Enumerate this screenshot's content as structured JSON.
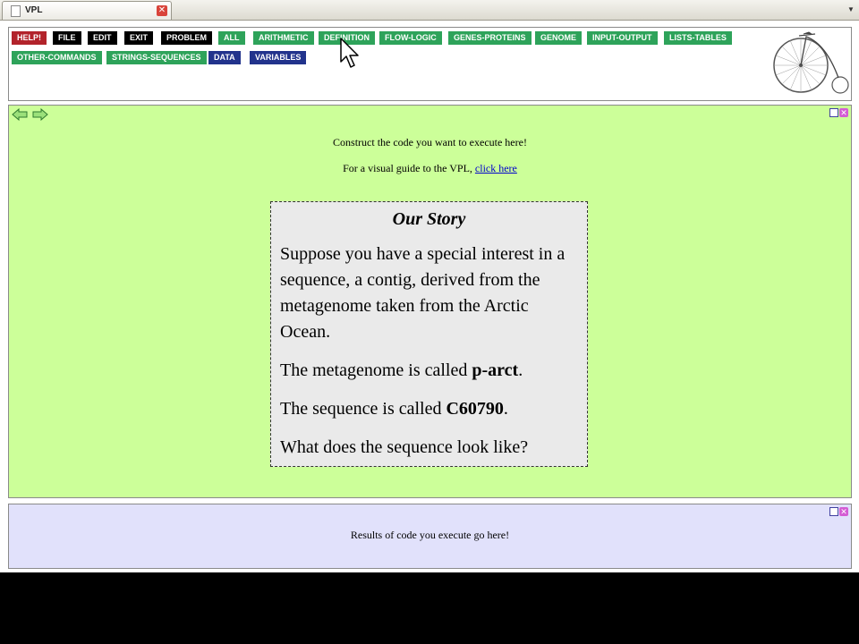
{
  "browser": {
    "tab_title": "VPL",
    "tab_close_glyph": "✕",
    "dropdown_glyph": "▼",
    "tab_icon": "page-icon"
  },
  "toolbar": {
    "buttons": [
      {
        "label": "HELP!",
        "color": "#b2232b"
      },
      {
        "label": "FILE",
        "color": "#000000"
      },
      {
        "label": "EDIT",
        "color": "#000000"
      },
      {
        "label": "EXIT",
        "color": "#000000"
      },
      {
        "label": "PROBLEM",
        "color": "#000000"
      },
      {
        "label": "ALL",
        "color": "#2ea35a"
      },
      {
        "label": "ARITHMETIC",
        "color": "#2ea35a"
      },
      {
        "label": "DEFINITION",
        "color": "#2ea35a"
      },
      {
        "label": "FLOW-LOGIC",
        "color": "#2ea35a"
      },
      {
        "label": "GENES-PROTEINS",
        "color": "#2ea35a"
      },
      {
        "label": "GENOME",
        "color": "#2ea35a"
      },
      {
        "label": "INPUT-OUTPUT",
        "color": "#2ea35a"
      },
      {
        "label": "LISTS-TABLES",
        "color": "#2ea35a"
      },
      {
        "label": "OTHER-COMMANDS",
        "color": "#2ea35a"
      },
      {
        "label": "STRINGS-SEQUENCES",
        "color": "#2ea35a"
      },
      {
        "label": "DATA",
        "color": "#22338c"
      },
      {
        "label": "VARIABLES",
        "color": "#22338c"
      }
    ],
    "logo": "penny-farthing-bicycle"
  },
  "code_panel": {
    "background": "#ccff99",
    "instruction": "Construct the code you want to execute here!",
    "guide_text": "For a visual guide to the VPL, ",
    "guide_link": "click here",
    "close_glyph": "✕"
  },
  "story": {
    "title": "Our Story",
    "paragraph1": "Suppose you have a special interest in a sequence, a contig, derived from the metagenome taken from the Arctic Ocean.",
    "p2_prefix": "The metagenome is called ",
    "p2_bold": "p-arct",
    "p2_suffix": ".",
    "p3_prefix": "The sequence is called ",
    "p3_bold": "C60790",
    "p3_suffix": ".",
    "paragraph4": "What does the sequence look like?"
  },
  "results_panel": {
    "background": "#e1e1fb",
    "text": "Results of code you execute go here!",
    "close_glyph": "✕"
  }
}
